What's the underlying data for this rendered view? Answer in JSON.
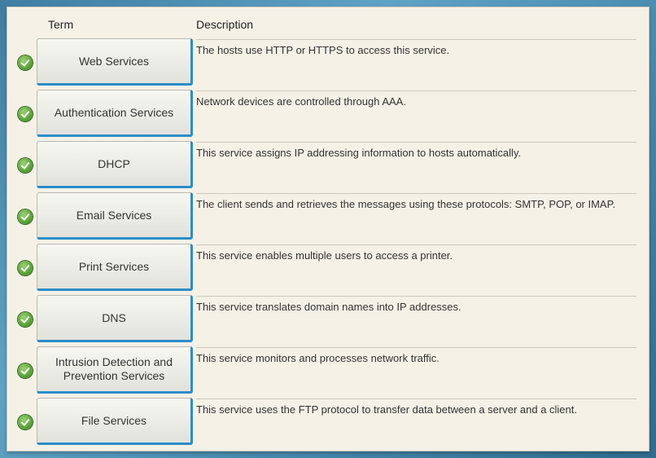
{
  "headers": {
    "term": "Term",
    "description": "Description"
  },
  "rows": [
    {
      "term": "Web Services",
      "description": "The hosts use HTTP or HTTPS to access this service."
    },
    {
      "term": "Authentication Services",
      "description": "Network devices are controlled through AAA."
    },
    {
      "term": "DHCP",
      "description": "This service assigns IP addressing information to hosts automatically."
    },
    {
      "term": "Email Services",
      "description": "The client sends and retrieves the messages using these protocols: SMTP, POP, or IMAP."
    },
    {
      "term": "Print Services",
      "description": "This service enables multiple users to access a printer."
    },
    {
      "term": "DNS",
      "description": "This service translates domain names into IP addresses."
    },
    {
      "term": "Intrusion Detection and Prevention Services",
      "description": "This service monitors and processes network traffic."
    },
    {
      "term": "File Services",
      "description": "This service uses the FTP protocol to transfer data between a server and a client."
    }
  ],
  "status_icon": "check-circle-icon",
  "colors": {
    "accent": "#2a8ec9",
    "check": "#5da83a",
    "panel": "#f5f1e7"
  }
}
